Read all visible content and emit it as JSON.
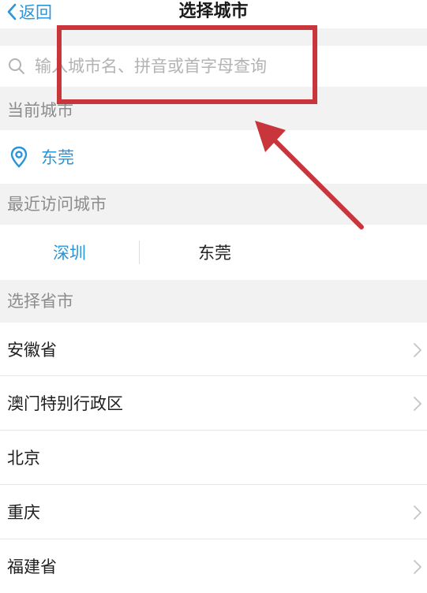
{
  "nav": {
    "back_label": "返回",
    "title": "选择城市"
  },
  "search": {
    "placeholder": "输入城市名、拼音或首字母查询"
  },
  "current": {
    "header": "当前城市",
    "city": "东莞"
  },
  "recent": {
    "header": "最近访问城市",
    "cities": [
      "深圳",
      "东莞"
    ]
  },
  "provinces": {
    "header": "选择省市",
    "items": [
      {
        "label": "安徽省"
      },
      {
        "label": "澳门特别行政区"
      },
      {
        "label": "北京"
      },
      {
        "label": "重庆"
      },
      {
        "label": "福建省"
      }
    ]
  },
  "colors": {
    "accent": "#2a95d8",
    "annotation": "#c8353b",
    "section_bg": "#f2f2f2"
  },
  "icons": [
    "chevron-left-icon",
    "search-icon",
    "location-pin-icon",
    "chevron-right-icon"
  ]
}
